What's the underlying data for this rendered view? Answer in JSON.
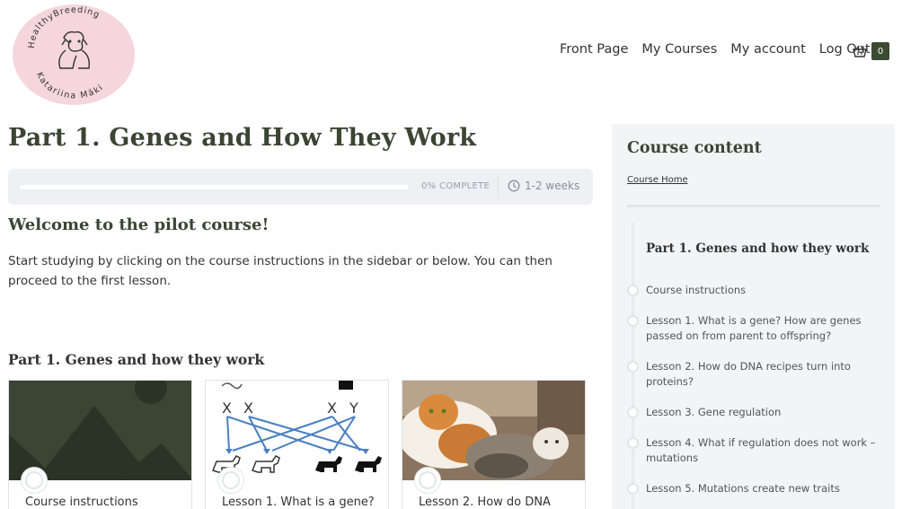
{
  "logo": {
    "top_text": "HealthyBreeding",
    "bottom_text": "Katariina Mäki",
    "bg_color": "#f5d5de"
  },
  "nav": {
    "items": [
      "Front Page",
      "My Courses",
      "My account",
      "Log Out"
    ],
    "cart_count": "0"
  },
  "page": {
    "title": "Part 1. Genes and How They Work",
    "progress_percent": 0,
    "progress_text": "0% COMPLETE",
    "duration": "1-2 weeks",
    "welcome_heading": "Welcome to the pilot course!",
    "intro": "Start studying by clicking on the course instructions in the sidebar or below. You can then proceed to the first lesson.",
    "section_title": "Part 1. Genes and how they work",
    "cards": [
      {
        "label": "Course instructions"
      },
      {
        "label": "Lesson 1. What is a gene?",
        "diagram_labels": [
          "X",
          "X",
          "X",
          "Y"
        ]
      },
      {
        "label": "Lesson 2. How do DNA"
      }
    ]
  },
  "sidebar": {
    "title": "Course content",
    "home_link": "Course Home",
    "section": "Part 1. Genes and how they work",
    "items": [
      "Course instructions",
      "Lesson 1. What is a gene? How are genes passed on from parent to offspring?",
      "Lesson 2. How do DNA recipes turn into proteins?",
      "Lesson 3. Gene regulation",
      "Lesson 4. What if regulation does not work – mutations",
      "Lesson 5. Mutations create new traits"
    ]
  },
  "colors": {
    "accent": "#3a4a33",
    "heading": "#3a4533",
    "arrow": "#4a7fc1"
  }
}
